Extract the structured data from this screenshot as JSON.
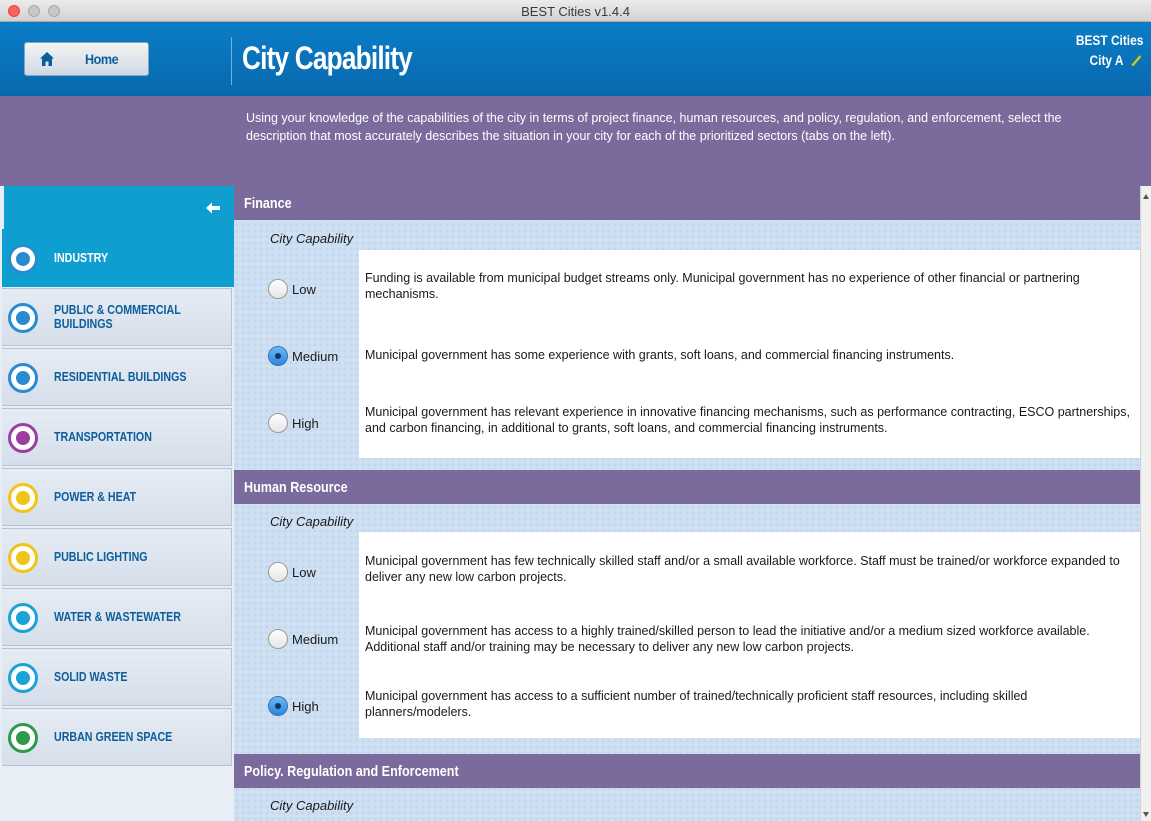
{
  "window": {
    "title": "BEST Cities v1.4.4"
  },
  "header": {
    "home_label": "Home",
    "page_title": "City Capability",
    "brand_line1": "BEST Cities",
    "brand_line2": "City A",
    "edit_icon": "pencil-icon"
  },
  "instructions": "Using your knowledge of the capabilities of the city in terms of project finance, human resources, and policy, regulation, and enforcement, select the description that most accurately describes the situation in your city for each of the prioritized sectors (tabs on the left).",
  "sidebar": {
    "collapse_icon": "arrow-left-icon",
    "items": [
      {
        "label": "INDUSTRY",
        "icon": "factory-icon",
        "color": "#2a8bd3",
        "active": true
      },
      {
        "label": "PUBLIC & COMMERCIAL BUILDINGS",
        "icon": "office-building-icon",
        "color": "#2a8bd3",
        "active": false
      },
      {
        "label": "RESIDENTIAL BUILDINGS",
        "icon": "house-icon",
        "color": "#2a8bd3",
        "active": false
      },
      {
        "label": "TRANSPORTATION",
        "icon": "bus-icon",
        "color": "#9b3fa0",
        "active": false
      },
      {
        "label": "POWER & HEAT",
        "icon": "lightning-icon",
        "color": "#f2c418",
        "active": false
      },
      {
        "label": "PUBLIC LIGHTING",
        "icon": "lightbulb-icon",
        "color": "#f2c418",
        "active": false
      },
      {
        "label": "WATER & WASTEWATER",
        "icon": "water-drop-icon",
        "color": "#1aa3d8",
        "active": false
      },
      {
        "label": "SOLID WASTE",
        "icon": "trash-icon",
        "color": "#1aa3d8",
        "active": false
      },
      {
        "label": "URBAN GREEN SPACE",
        "icon": "tree-icon",
        "color": "#2f9a4c",
        "active": false
      }
    ]
  },
  "sections": [
    {
      "title": "Finance",
      "cap_label": "City Capability",
      "selected": "Medium",
      "options": [
        {
          "label": "Low",
          "desc": "Funding is available from municipal budget streams only. Municipal government has no experience of other financial or partnering mechanisms."
        },
        {
          "label": "Medium",
          "desc": "Municipal government has some experience with grants, soft loans, and commercial financing instruments."
        },
        {
          "label": "High",
          "desc": "Municipal government has relevant experience in innovative financing mechanisms, such as performance contracting, ESCO partnerships, and carbon financing, in additional to grants, soft loans, and commercial financing instruments."
        }
      ]
    },
    {
      "title": "Human Resource",
      "cap_label": "City Capability",
      "selected": "High",
      "options": [
        {
          "label": "Low",
          "desc": "Municipal government has few technically skilled staff and/or a small available workforce. Staff must be trained/or workforce expanded to deliver any new low carbon projects."
        },
        {
          "label": "Medium",
          "desc": "Municipal government has access to a highly trained/skilled person to lead the initiative and/or a medium sized workforce available. Additional staff and/or training may be necessary to deliver any new low carbon projects."
        },
        {
          "label": "High",
          "desc": "Municipal government has access to a sufficient number of trained/technically proficient staff resources, including skilled planners/modelers."
        }
      ]
    },
    {
      "title": "Policy. Regulation and Enforcement",
      "cap_label": "City Capability"
    }
  ]
}
